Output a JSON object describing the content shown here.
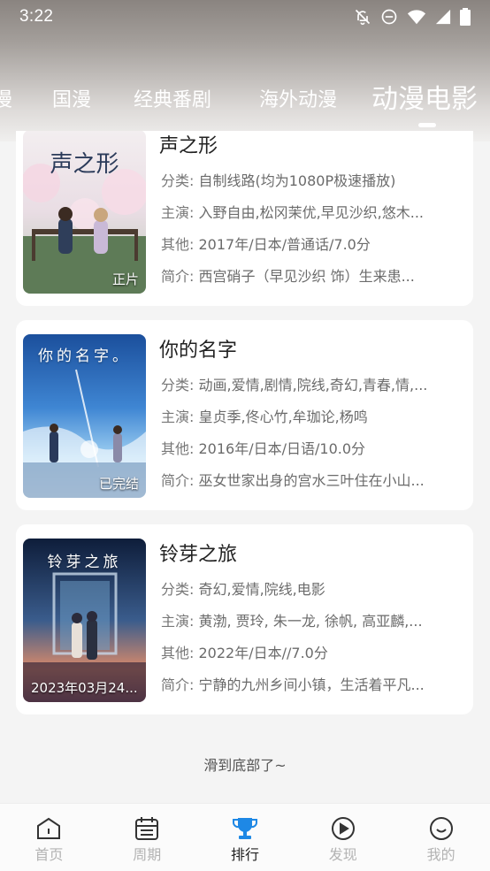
{
  "status_bar": {
    "time": "3:22",
    "icons": [
      "bell-off-icon",
      "do-not-disturb-icon",
      "wifi-icon",
      "signal-icon",
      "battery-icon"
    ]
  },
  "tabs": {
    "items": [
      "漫",
      "国漫",
      "经典番剧",
      "海外动漫",
      "动漫电影"
    ],
    "active": "动漫电影"
  },
  "cards": [
    {
      "title": "声之形",
      "poster_text": "声之形",
      "badge": "正片",
      "category": {
        "key": "分类:",
        "value": "自制线路(均为1080P极速播放)"
      },
      "cast": {
        "key": "主演:",
        "value": "入野自由,松冈茉优,早见沙织,悠木..."
      },
      "other": {
        "key": "其他:",
        "value": "2017年/日本/普通话/7.0分"
      },
      "intro": {
        "key": "简介:",
        "value": "西宫硝子（早见沙织 饰）生来患..."
      }
    },
    {
      "title": "你的名字",
      "poster_text": "你的名字。",
      "badge": "已完结",
      "category": {
        "key": "分类:",
        "value": "动画,爱情,剧情,院线,奇幻,青春,情,..."
      },
      "cast": {
        "key": "主演:",
        "value": "皇贞季,佟心竹,牟珈论,杨鸣"
      },
      "other": {
        "key": "其他:",
        "value": "2016年/日本/日语/10.0分"
      },
      "intro": {
        "key": "简介:",
        "value": "巫女世家出身的宫水三叶住在小山..."
      }
    },
    {
      "title": "铃芽之旅",
      "poster_text": "铃芽之旅",
      "badge": "2023年03月24...",
      "category": {
        "key": "分类:",
        "value": "奇幻,爱情,院线,电影"
      },
      "cast": {
        "key": "主演:",
        "value": "黄渤, 贾玲, 朱一龙, 徐帆, 高亚麟,..."
      },
      "other": {
        "key": "其他:",
        "value": "2022年/日本//7.0分"
      },
      "intro": {
        "key": "简介:",
        "value": "宁静的九州乡间小镇，生活着平凡..."
      }
    }
  ],
  "end_text": "滑到底部了~",
  "bottom_nav": [
    {
      "label": "首页",
      "icon": "home-icon"
    },
    {
      "label": "周期",
      "icon": "calendar-icon"
    },
    {
      "label": "排行",
      "icon": "trophy-icon",
      "active": true
    },
    {
      "label": "发现",
      "icon": "play-circle-icon"
    },
    {
      "label": "我的",
      "icon": "smile-icon"
    }
  ],
  "colors": {
    "accent": "#1e88e5",
    "nav_inactive": "#b3b3b3",
    "nav_active": "#222222"
  }
}
